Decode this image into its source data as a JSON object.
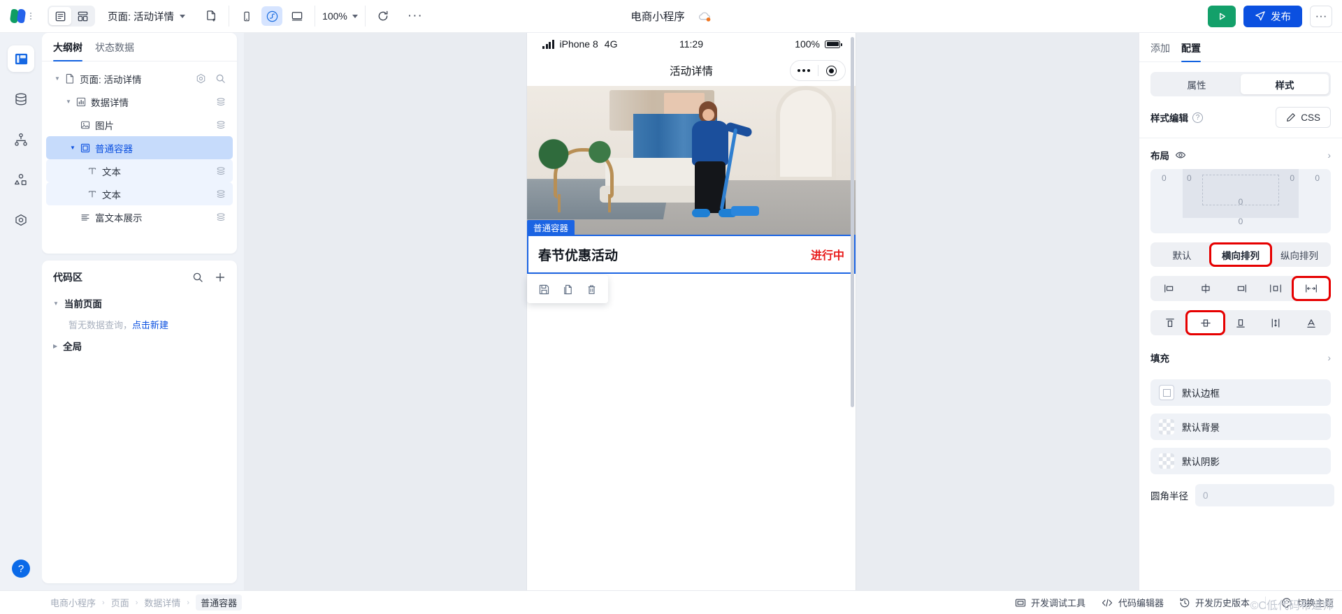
{
  "topbar": {
    "view_toggles": [
      {
        "name": "page-view",
        "icon": "page-layout-icon",
        "active": true
      },
      {
        "name": "grid-view",
        "icon": "grid-layout-icon",
        "active": false
      }
    ],
    "page_selector_label": "页面: 活动详情",
    "new_page_icon": "new-file-icon",
    "device_icons": [
      {
        "name": "mobile-device",
        "icon": "phone-icon",
        "active": false
      },
      {
        "name": "mini-program-device",
        "icon": "wechat-miniprogram-icon",
        "active": true
      },
      {
        "name": "desktop-device",
        "icon": "desktop-icon",
        "active": false
      }
    ],
    "zoom_label": "100%",
    "refresh_icon": "refresh-icon",
    "more_icon": "ellipsis-icon",
    "project_title": "电商小程序",
    "cloud_icon": "cloud-status-icon",
    "run_label": "",
    "publish_label": "发布",
    "more_right_label": "···"
  },
  "rail": {
    "items": [
      {
        "name": "sidebar-item-layout",
        "icon": "layout-panel-icon",
        "active": true
      },
      {
        "name": "sidebar-item-data",
        "icon": "database-icon",
        "active": false
      },
      {
        "name": "sidebar-item-flow",
        "icon": "sitemap-icon",
        "active": false
      },
      {
        "name": "sidebar-item-components",
        "icon": "shapes-icon",
        "active": false
      },
      {
        "name": "sidebar-item-settings",
        "icon": "hexagon-gear-icon",
        "active": false
      }
    ],
    "help_label": "?"
  },
  "left_panel": {
    "tabs": [
      {
        "label": "大纲树",
        "active": true
      },
      {
        "label": "状态数据",
        "active": false
      }
    ],
    "tree": [
      {
        "label": "页面: 活动详情",
        "icon": "file-icon",
        "depth": 0,
        "expanded": true,
        "selected": false,
        "actions": [
          "target-icon",
          "search-icon"
        ]
      },
      {
        "label": "数据详情",
        "icon": "chart-box-icon",
        "depth": 1,
        "expanded": true,
        "selected": false,
        "actions": [
          "layers-icon"
        ]
      },
      {
        "label": "图片",
        "icon": "image-icon",
        "depth": 2,
        "expanded": null,
        "selected": false,
        "actions": [
          "layers-icon"
        ]
      },
      {
        "label": "普通容器",
        "icon": "container-icon",
        "depth": 2,
        "expanded": true,
        "selected": true,
        "actions": []
      },
      {
        "label": "文本",
        "icon": "text-icon",
        "depth": 3,
        "expanded": null,
        "selected": false,
        "highlight": true,
        "actions": [
          "layers-icon"
        ]
      },
      {
        "label": "文本",
        "icon": "text-icon",
        "depth": 3,
        "expanded": null,
        "selected": false,
        "highlight": true,
        "actions": [
          "layers-icon"
        ]
      },
      {
        "label": "富文本展示",
        "icon": "rich-text-icon",
        "depth": 2,
        "expanded": null,
        "selected": false,
        "actions": [
          "layers-icon"
        ]
      }
    ],
    "code_area": {
      "title": "代码区",
      "search_icon": "search-icon",
      "add_icon": "plus-icon",
      "groups": [
        {
          "label": "当前页面",
          "expanded": true
        },
        {
          "label": "全局",
          "expanded": false
        }
      ],
      "empty_text": "暂无数据查询，",
      "empty_link": "点击新建"
    }
  },
  "preview": {
    "status_bar": {
      "signal_icon": "signal-bars-icon",
      "device": "iPhone 8",
      "network": "4G",
      "time": "11:29",
      "battery_percent": "100%",
      "battery_icon": "battery-full-icon"
    },
    "nav_title": "活动详情",
    "capsule": {
      "more_icon": "capsule-more-icon",
      "target_icon": "capsule-target-icon"
    },
    "selected_component": {
      "tag": "普通容器",
      "title": "春节优惠活动",
      "status": "进行中",
      "status_color": "#e81b1b",
      "accent_color": "#1b64e3"
    },
    "toolbar_icons": [
      {
        "name": "save-component-button",
        "icon": "save-icon"
      },
      {
        "name": "copy-component-button",
        "icon": "copy-icon"
      },
      {
        "name": "delete-component-button",
        "icon": "trash-icon"
      }
    ]
  },
  "right_panel": {
    "tabs": [
      {
        "label": "添加",
        "active": false
      },
      {
        "label": "配置",
        "active": true
      }
    ],
    "segment": [
      {
        "label": "属性",
        "active": false
      },
      {
        "label": "样式",
        "active": true
      }
    ],
    "style_edit": {
      "label": "样式编辑",
      "help_icon": "question-icon",
      "css_button": "CSS",
      "edit_icon": "pencil-icon"
    },
    "layout_section": {
      "title": "布局",
      "eye_icon": "eye-icon",
      "chevron": "›"
    },
    "box_model": {
      "values": [
        "0",
        "0",
        "0",
        "0",
        "0",
        "0"
      ]
    },
    "direction_segment": [
      {
        "label": "默认",
        "active": false,
        "highlighted": false
      },
      {
        "label": "横向排列",
        "active": true,
        "highlighted": true
      },
      {
        "label": "纵向排列",
        "active": false,
        "highlighted": false
      }
    ],
    "justify_icons": [
      {
        "name": "justify-start",
        "icon": "align-left-icon",
        "active": false,
        "highlighted": false
      },
      {
        "name": "justify-center",
        "icon": "align-center-icon",
        "active": false,
        "highlighted": false
      },
      {
        "name": "justify-end",
        "icon": "align-right-icon",
        "active": false,
        "highlighted": false
      },
      {
        "name": "justify-space-around",
        "icon": "space-around-icon",
        "active": false,
        "highlighted": false
      },
      {
        "name": "justify-space-between",
        "icon": "space-between-icon",
        "active": true,
        "highlighted": true
      }
    ],
    "align_icons": [
      {
        "name": "align-top",
        "icon": "align-top-icon",
        "active": false,
        "highlighted": false
      },
      {
        "name": "align-middle",
        "icon": "align-middle-icon",
        "active": true,
        "highlighted": true
      },
      {
        "name": "align-bottom",
        "icon": "align-bottom-icon",
        "active": false,
        "highlighted": false
      },
      {
        "name": "align-stretch",
        "icon": "stretch-icon",
        "active": false,
        "highlighted": false
      },
      {
        "name": "align-baseline",
        "icon": "baseline-icon",
        "active": false,
        "highlighted": false
      }
    ],
    "fill_section": {
      "title": "填充",
      "chevron": "›"
    },
    "fill_rows": [
      {
        "label": "默认边框",
        "swatch": "border"
      },
      {
        "label": "默认背景",
        "swatch": "checker"
      },
      {
        "label": "默认阴影",
        "swatch": "checker"
      }
    ],
    "radius": {
      "label": "圆角半径",
      "value": "",
      "placeholder": "0",
      "expand_icon": "expand-corners-icon"
    }
  },
  "bottom_bar": {
    "breadcrumb": [
      "电商小程序",
      "页面",
      "数据详情",
      "普通容器"
    ],
    "separator": "›",
    "actions": [
      {
        "label": "开发调试工具",
        "icon": "debug-tool-icon"
      },
      {
        "label": "代码编辑器",
        "icon": "code-editor-icon"
      },
      {
        "label": "开发历史版本",
        "icon": "history-icon"
      }
    ],
    "theme": {
      "label": "切换主题",
      "icon": "palette-icon"
    },
    "watermark": "©C低代码布道师"
  }
}
